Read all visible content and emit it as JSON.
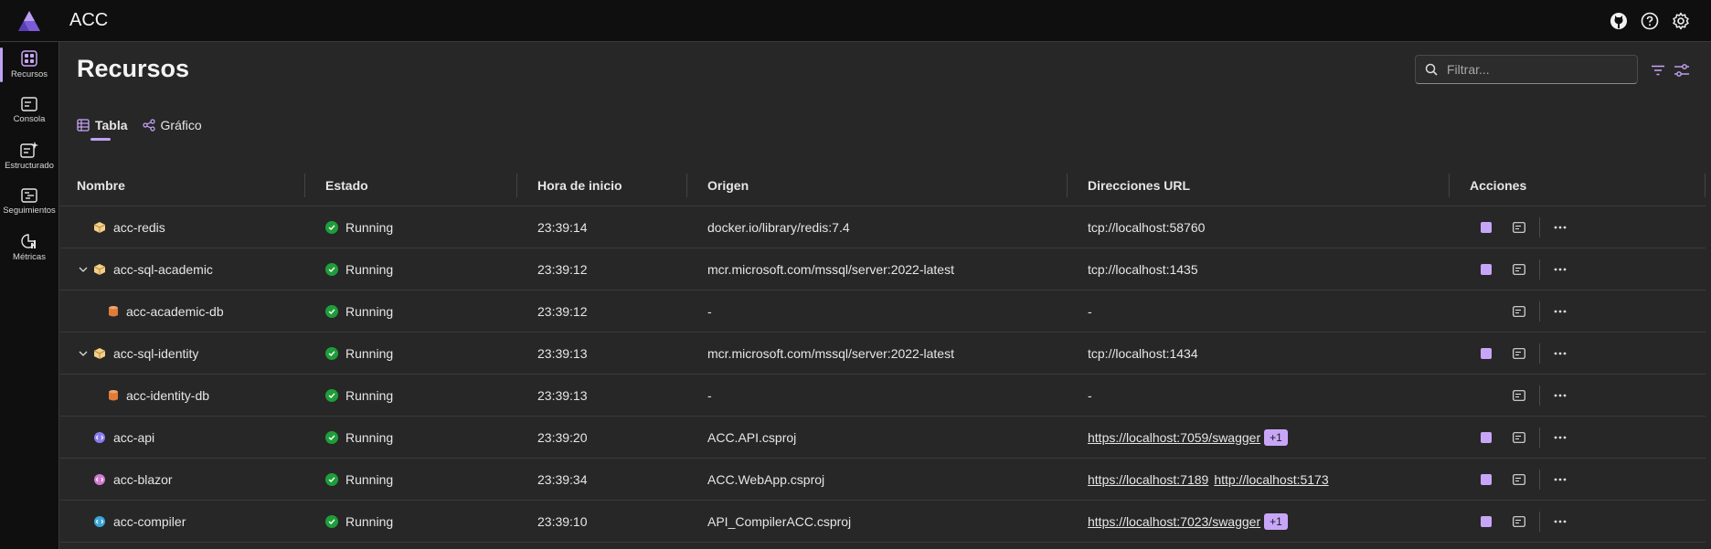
{
  "app": {
    "title": "ACC"
  },
  "sidebar": {
    "items": [
      {
        "label": "Recursos",
        "icon": "resources-icon",
        "active": true
      },
      {
        "label": "Consola",
        "icon": "console-icon"
      },
      {
        "label": "Estructurado",
        "icon": "structured-logs-icon"
      },
      {
        "label": "Seguimientos",
        "icon": "traces-icon"
      },
      {
        "label": "Métricas",
        "icon": "metrics-icon"
      }
    ]
  },
  "page": {
    "title": "Recursos"
  },
  "filter": {
    "placeholder": "Filtrar..."
  },
  "tabs": [
    {
      "label": "Tabla",
      "active": true
    },
    {
      "label": "Gráfico"
    }
  ],
  "table": {
    "columns": [
      "Nombre",
      "Estado",
      "Hora de inicio",
      "Origen",
      "Direcciones URL",
      "Acciones"
    ],
    "rows": [
      {
        "name": "acc-redis",
        "type": "container",
        "state": "Running",
        "time": "23:39:14",
        "origin": "docker.io/library/redis:7.4",
        "url": "tcp://localhost:58760"
      },
      {
        "name": "acc-sql-academic",
        "type": "container",
        "expandable": true,
        "state": "Running",
        "time": "23:39:12",
        "origin": "mcr.microsoft.com/mssql/server:2022-latest",
        "url": "tcp://localhost:1435"
      },
      {
        "name": "acc-academic-db",
        "type": "database",
        "child": true,
        "state": "Running",
        "time": "23:39:12",
        "origin": "-",
        "url": "-"
      },
      {
        "name": "acc-sql-identity",
        "type": "container",
        "expandable": true,
        "state": "Running",
        "time": "23:39:13",
        "origin": "mcr.microsoft.com/mssql/server:2022-latest",
        "url": "tcp://localhost:1434"
      },
      {
        "name": "acc-identity-db",
        "type": "database",
        "child": true,
        "state": "Running",
        "time": "23:39:13",
        "origin": "-",
        "url": "-"
      },
      {
        "name": "acc-api",
        "type": "project",
        "state": "Running",
        "time": "23:39:20",
        "origin": "ACC.API.csproj",
        "url": "https://localhost:7059/swagger",
        "badge": "+1"
      },
      {
        "name": "acc-blazor",
        "type": "project",
        "state": "Running",
        "time": "23:39:34",
        "origin": "ACC.WebApp.csproj",
        "url": "https://localhost:7189",
        "url2": "http://localhost:5173"
      },
      {
        "name": "acc-compiler",
        "type": "project",
        "state": "Running",
        "time": "23:39:10",
        "origin": "API_CompilerACC.csproj",
        "url": "https://localhost:7023/swagger",
        "badge": "+1"
      }
    ]
  },
  "colors": {
    "accent": "#c8a6f7",
    "running": "#1f9d3a",
    "background": "#272727",
    "chrome": "#0f0f0f"
  }
}
